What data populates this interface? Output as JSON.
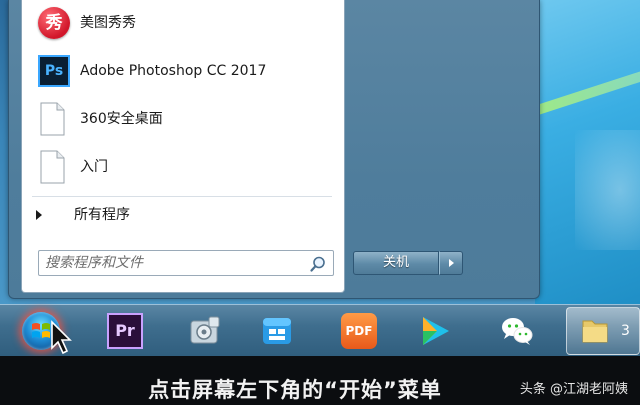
{
  "start_menu": {
    "programs": [
      {
        "label": "美图秀秀",
        "icon": "meitu-icon",
        "glyph": "秀"
      },
      {
        "label": "Adobe Photoshop CC 2017",
        "icon": "photoshop-icon",
        "glyph": "Ps"
      },
      {
        "label": "360安全桌面",
        "icon": "document-icon"
      },
      {
        "label": "入门",
        "icon": "document-icon"
      }
    ],
    "all_programs_label": "所有程序",
    "search": {
      "placeholder": "搜索程序和文件"
    },
    "shutdown_label": "关机"
  },
  "taskbar": {
    "items": [
      {
        "name": "start-orb",
        "icon": "windows-flag-icon"
      },
      {
        "name": "premiere",
        "icon": "premiere-icon",
        "glyph": "Pr"
      },
      {
        "name": "media-center",
        "icon": "media-icon"
      },
      {
        "name": "file-explorer",
        "icon": "explorer-icon"
      },
      {
        "name": "pdf-app",
        "icon": "pdf-icon",
        "glyph": "PDF"
      },
      {
        "name": "video-player",
        "icon": "play-icon"
      },
      {
        "name": "wechat",
        "icon": "wechat-icon"
      },
      {
        "name": "folder",
        "icon": "folder-icon",
        "count": "3"
      }
    ]
  },
  "caption": "点击屏幕左下角的“开始”菜单",
  "watermark": "头条 @江湖老阿姨",
  "colors": {
    "taskbar": "#3f6e8e",
    "menu_frame": "#4f7d9c",
    "start_glow": "#ff503c"
  }
}
